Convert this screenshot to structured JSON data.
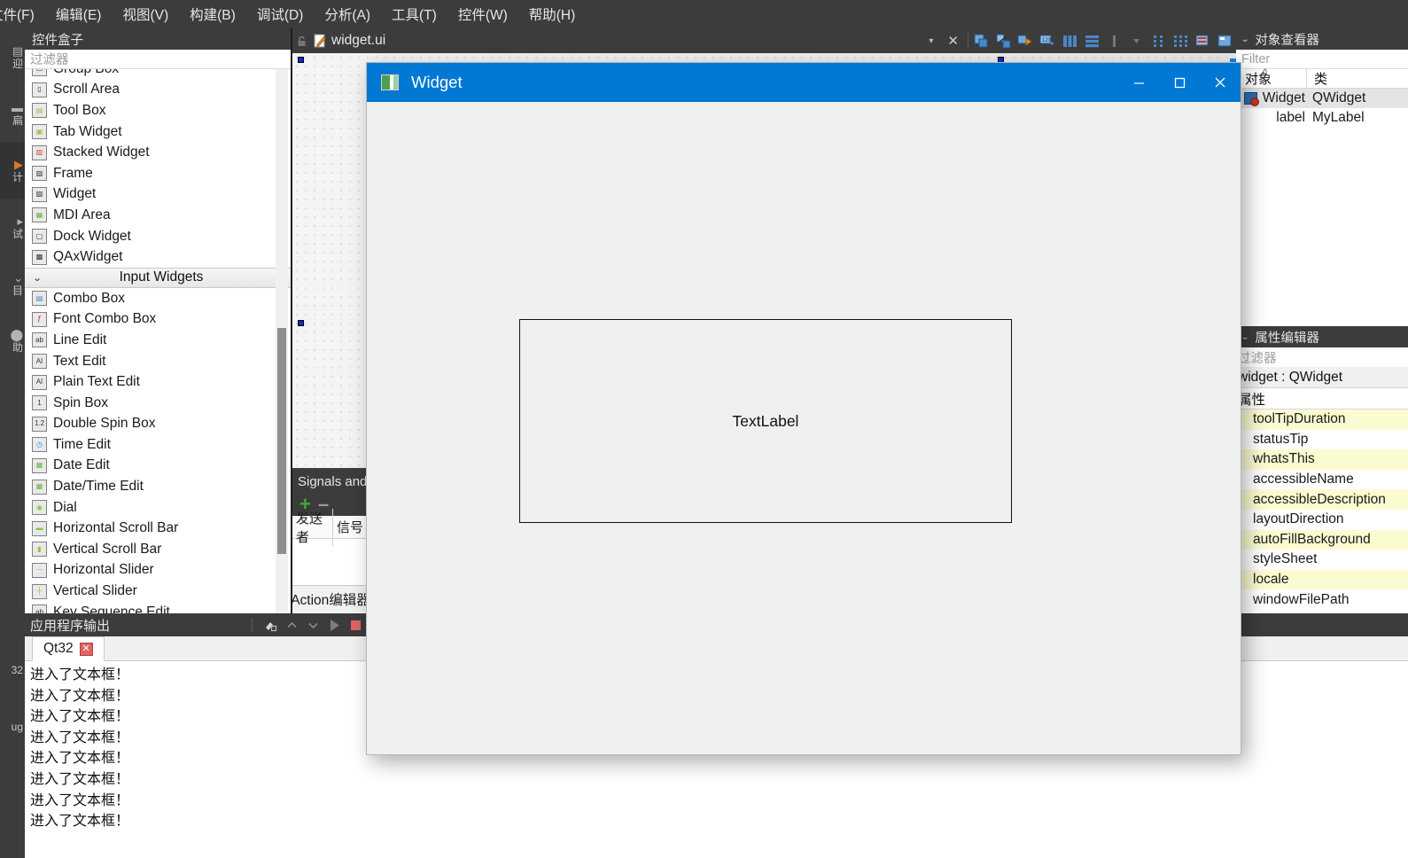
{
  "menubar": {
    "items": [
      {
        "label": "文件(F)"
      },
      {
        "label": "编辑(E)"
      },
      {
        "label": "视图(V)"
      },
      {
        "label": "构建(B)"
      },
      {
        "label": "调试(D)"
      },
      {
        "label": "分析(A)"
      },
      {
        "label": "工具(T)"
      },
      {
        "label": "控件(W)"
      },
      {
        "label": "帮助(H)"
      }
    ]
  },
  "mode_strip": {
    "items": [
      {
        "glyph": "▤",
        "label": "迎"
      },
      {
        "glyph": "▬",
        "label": "扁"
      },
      {
        "glyph": "▶",
        "label": "计",
        "active": true
      },
      {
        "glyph": "▸",
        "label": "试"
      },
      {
        "glyph": "⌄",
        "label": "目"
      },
      {
        "glyph": "⬤",
        "label": "助"
      }
    ],
    "bottom_items": [
      {
        "label": "32"
      },
      {
        "label": "ug"
      }
    ]
  },
  "widget_box": {
    "title": "控件盒子",
    "filter_placeholder": "过滤器",
    "items": [
      {
        "label": "Group Box",
        "icon": "groupbox-icon",
        "type": "item",
        "clipped": true
      },
      {
        "label": "Scroll Area",
        "icon": "scrollarea-icon",
        "type": "item"
      },
      {
        "label": "Tool Box",
        "icon": "toolbox-icon",
        "type": "item"
      },
      {
        "label": "Tab Widget",
        "icon": "tabwidget-icon",
        "type": "item"
      },
      {
        "label": "Stacked Widget",
        "icon": "stackedwidget-icon",
        "type": "item"
      },
      {
        "label": "Frame",
        "icon": "frame-icon",
        "type": "item"
      },
      {
        "label": "Widget",
        "icon": "widget-icon",
        "type": "item"
      },
      {
        "label": "MDI Area",
        "icon": "mdiarea-icon",
        "type": "item"
      },
      {
        "label": "Dock Widget",
        "icon": "dockwidget-icon",
        "type": "item"
      },
      {
        "label": "QAxWidget",
        "icon": "qaxwidget-icon",
        "type": "item"
      },
      {
        "label": "Input Widgets",
        "icon": "chevron-down-icon",
        "type": "category"
      },
      {
        "label": "Combo Box",
        "icon": "combobox-icon",
        "type": "item"
      },
      {
        "label": "Font Combo Box",
        "icon": "fontcombobox-icon",
        "type": "item"
      },
      {
        "label": "Line Edit",
        "icon": "lineedit-icon",
        "type": "item"
      },
      {
        "label": "Text Edit",
        "icon": "textedit-icon",
        "type": "item"
      },
      {
        "label": "Plain Text Edit",
        "icon": "plaintextedit-icon",
        "type": "item"
      },
      {
        "label": "Spin Box",
        "icon": "spinbox-icon",
        "type": "item"
      },
      {
        "label": "Double Spin Box",
        "icon": "doublespinbox-icon",
        "type": "item"
      },
      {
        "label": "Time Edit",
        "icon": "timeedit-icon",
        "type": "item"
      },
      {
        "label": "Date Edit",
        "icon": "dateedit-icon",
        "type": "item"
      },
      {
        "label": "Date/Time Edit",
        "icon": "datetimeedit-icon",
        "type": "item"
      },
      {
        "label": "Dial",
        "icon": "dial-icon",
        "type": "item"
      },
      {
        "label": "Horizontal Scroll Bar",
        "icon": "hscrollbar-icon",
        "type": "item"
      },
      {
        "label": "Vertical Scroll Bar",
        "icon": "vscrollbar-icon",
        "type": "item"
      },
      {
        "label": "Horizontal Slider",
        "icon": "hslider-icon",
        "type": "item"
      },
      {
        "label": "Vertical Slider",
        "icon": "vslider-icon",
        "type": "item"
      },
      {
        "label": "Key Sequence Edit",
        "icon": "keysequenceedit-icon",
        "type": "item",
        "clipped": true
      }
    ]
  },
  "editor": {
    "filename": "widget.ui",
    "dropdown_glyph": "▾",
    "close_glyph": "✕",
    "toolbar_buttons": [
      {
        "name": "edit-widgets-icon"
      },
      {
        "name": "edit-signals-slots-icon"
      },
      {
        "name": "edit-buddies-icon"
      },
      {
        "name": "edit-tab-order-icon"
      },
      {
        "name": "layout-horizontally-icon"
      },
      {
        "name": "layout-vertically-icon"
      },
      {
        "name": "layout-splitter-horizontal-icon"
      },
      {
        "name": "layout-splitter-vertical-icon"
      },
      {
        "name": "layout-form-icon"
      },
      {
        "name": "layout-grid-icon"
      },
      {
        "name": "break-layout-icon"
      },
      {
        "name": "adjust-size-icon"
      }
    ]
  },
  "signals_dock": {
    "title": "Signals and Slots 编辑器",
    "add_glyph": "+",
    "remove_glyph": "–",
    "columns": [
      "发送者",
      "信号"
    ]
  },
  "action_dock": {
    "title": "Action编辑器"
  },
  "object_inspector": {
    "title": "对象查看器",
    "filter_placeholder": "Filter",
    "columns": [
      "对象",
      "类"
    ],
    "sort_glyph": "^",
    "rows": [
      {
        "name": "Widget",
        "class": "QWidget",
        "selected": true,
        "has_icon": true
      },
      {
        "name": "label",
        "class": "MyLabel",
        "selected": false,
        "has_icon": false
      }
    ]
  },
  "property_editor": {
    "title": "属性编辑器",
    "filter_placeholder": "过滤器",
    "object_line": "widget : QWidget",
    "header": "属性",
    "rows": [
      {
        "name": "toolTipDuration"
      },
      {
        "name": "statusTip"
      },
      {
        "name": "whatsThis"
      },
      {
        "name": "accessibleName"
      },
      {
        "name": "accessibleDescription"
      },
      {
        "name": "layoutDirection"
      },
      {
        "name": "autoFillBackground"
      },
      {
        "name": "styleSheet"
      },
      {
        "name": "locale"
      },
      {
        "name": "windowFilePath"
      }
    ]
  },
  "output_pane": {
    "title": "应用程序输出",
    "tab": {
      "label": "Qt32",
      "close_glyph": "✕"
    },
    "toolbar": [
      {
        "name": "clear-output-icon"
      },
      {
        "name": "prev-item-icon"
      },
      {
        "name": "next-item-icon"
      },
      {
        "name": "run-icon"
      },
      {
        "name": "stop-icon"
      },
      {
        "name": "run-debug-icon"
      },
      {
        "name": "settings-icon"
      },
      {
        "name": "zoom-icon"
      }
    ],
    "lines": [
      "进入了文本框！",
      "进入了文本框！",
      "进入了文本框！",
      "进入了文本框！",
      "进入了文本框！",
      "进入了文本框！",
      "进入了文本框！",
      "进入了文本框！"
    ]
  },
  "preview_window": {
    "title": "Widget",
    "minimize_glyph": "—",
    "maximize_glyph": "□",
    "close_glyph": "✕",
    "label_text": "TextLabel",
    "titlebar_color": "#0078d4"
  }
}
